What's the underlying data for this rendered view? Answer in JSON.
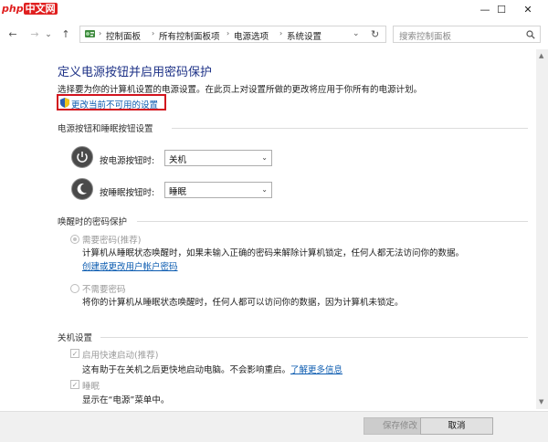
{
  "watermark": {
    "prefix": "php",
    "suffix": "中文网"
  },
  "window": {
    "minimize": "—",
    "maximize": "☐",
    "close": "✕"
  },
  "nav": {
    "back": "←",
    "forward": "→",
    "dropdown": "⌄",
    "up": "↑",
    "refresh": "↻",
    "breadcrumbs": [
      "控制面板",
      "所有控制面板项",
      "电源选项",
      "系统设置"
    ],
    "separator": "›",
    "search_placeholder": "搜索控制面板"
  },
  "page": {
    "title": "定义电源按钮并启用密码保护",
    "description": "选择要为你的计算机设置的电源设置。在此页上对设置所做的更改将应用于你所有的电源计划。",
    "change_link": "更改当前不可用的设置"
  },
  "power_buttons": {
    "section_title": "电源按钮和睡眠按钮设置",
    "power_label": "按电源按钮时:",
    "power_value": "关机",
    "sleep_label": "按睡眠按钮时:",
    "sleep_value": "睡眠"
  },
  "password": {
    "section_title": "唤醒时的密码保护",
    "option1_label": "需要密码(推荐)",
    "option1_desc": "计算机从睡眠状态唤醒时，如果未输入正确的密码来解除计算机锁定，任何人都无法访问你的数据。",
    "option1_link": "创建或更改用户帐户密码",
    "option2_label": "不需要密码",
    "option2_desc": "将你的计算机从睡眠状态唤醒时，任何人都可以访问你的数据，因为计算机未锁定。"
  },
  "shutdown": {
    "section_title": "关机设置",
    "fast_label": "启用快速启动(推荐)",
    "fast_desc": "这有助于在关机之后更快地启动电脑。不会影响重启。",
    "fast_link": "了解更多信息",
    "sleep_label": "睡眠",
    "sleep_desc": "显示在“电源”菜单中。",
    "check_mark": "✓"
  },
  "footer": {
    "save": "保存修改",
    "cancel": "取消"
  },
  "colors": {
    "title_blue": "#1e3287",
    "link_blue": "#0b5bb0",
    "highlight_red": "#d2141e"
  }
}
